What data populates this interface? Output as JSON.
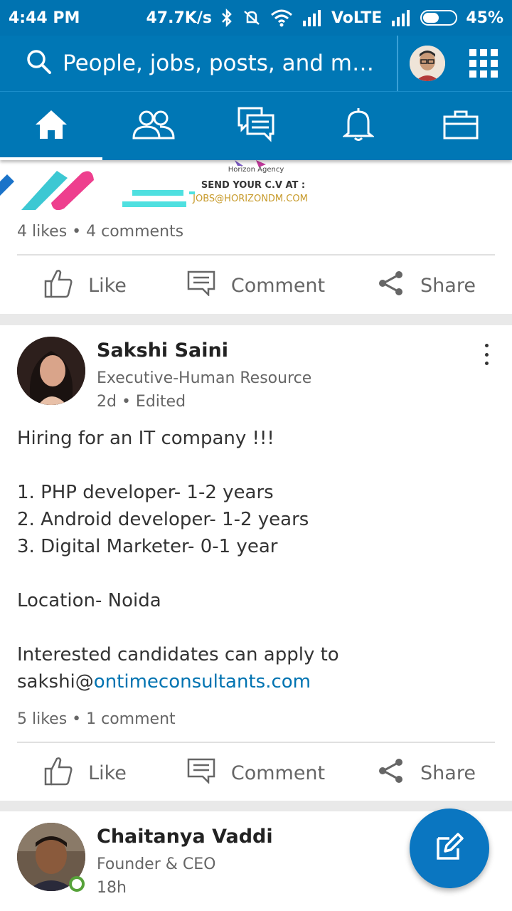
{
  "status_bar": {
    "time": "4:44 PM",
    "speed": "47.7K/s",
    "network": "VoLTE",
    "battery": "45%"
  },
  "search": {
    "placeholder": "People, jobs, posts, and more…"
  },
  "nav": {
    "tabs": [
      {
        "name": "home",
        "active": true
      },
      {
        "name": "my-network",
        "active": false
      },
      {
        "name": "messaging",
        "active": false
      },
      {
        "name": "notifications",
        "active": false
      },
      {
        "name": "jobs",
        "active": false
      }
    ]
  },
  "posts": [
    {
      "banner": {
        "agency": "Horizon Agency",
        "line1": "SEND YOUR C.V AT :",
        "line2": "JOBS@HORIZONDM.COM"
      },
      "counts": "4 likes • 4 comments"
    },
    {
      "author": "Sakshi Saini",
      "headline": "Executive-Human Resource",
      "meta": "2d • Edited",
      "body": [
        "Hiring for an IT company !!!",
        "",
        "1. PHP developer- 1-2 years",
        "2. Android developer- 1-2 years",
        "3. Digital Marketer- 0-1 year",
        "",
        "Location- Noida",
        "",
        "Interested candidates can apply to"
      ],
      "email_prefix": "sakshi@",
      "email_link": "ontimeconsultants.com",
      "counts": "5 likes • 1 comment"
    },
    {
      "author": "Chaitanya Vaddi",
      "headline": "Founder & CEO",
      "meta": "18h"
    }
  ],
  "actions": {
    "like": "Like",
    "comment": "Comment",
    "share": "Share"
  },
  "colors": {
    "brand": "#0077b5",
    "link": "#0073b1",
    "online": "#57a23a"
  }
}
